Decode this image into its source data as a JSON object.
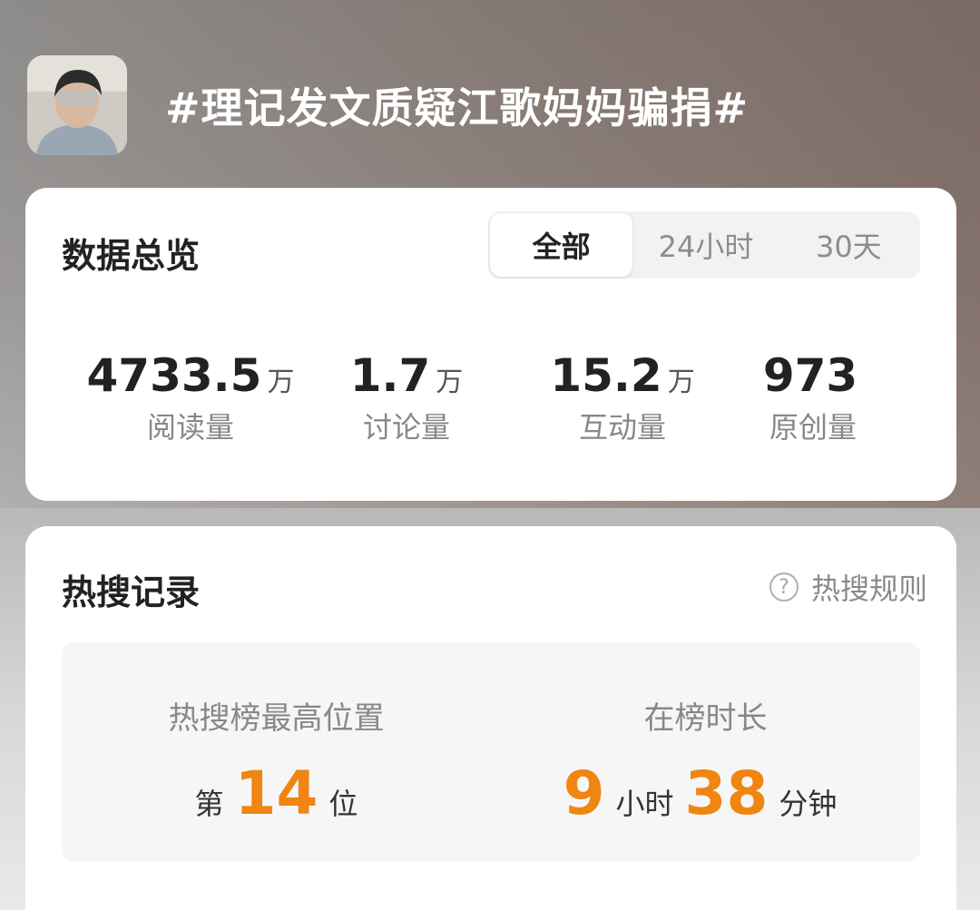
{
  "header": {
    "title": "#理记发文质疑江歌妈妈骗捐#"
  },
  "overview": {
    "title": "数据总览",
    "tabs": [
      {
        "label": "全部",
        "active": true
      },
      {
        "label": "24小时",
        "active": false
      },
      {
        "label": "30天",
        "active": false
      }
    ],
    "stats": [
      {
        "value": "4733.5",
        "unit": "万",
        "label": "阅读量"
      },
      {
        "value": "1.7",
        "unit": "万",
        "label": "讨论量"
      },
      {
        "value": "15.2",
        "unit": "万",
        "label": "互动量"
      },
      {
        "value": "973",
        "unit": "",
        "label": "原创量"
      }
    ]
  },
  "hot": {
    "title": "热搜记录",
    "rules_label": "热搜规则",
    "rules_icon_glyph": "?",
    "peak": {
      "label": "热搜榜最高位置",
      "prefix": "第",
      "value": "14",
      "suffix": "位"
    },
    "duration": {
      "label": "在榜时长",
      "hours": "9",
      "hours_unit": "小时",
      "minutes": "38",
      "minutes_unit": "分钟"
    }
  },
  "colors": {
    "accent": "#f08512",
    "card": "#ffffff",
    "text_primary": "#222222",
    "text_secondary": "#888888"
  },
  "icons": [
    "avatar",
    "question-circle-icon"
  ]
}
